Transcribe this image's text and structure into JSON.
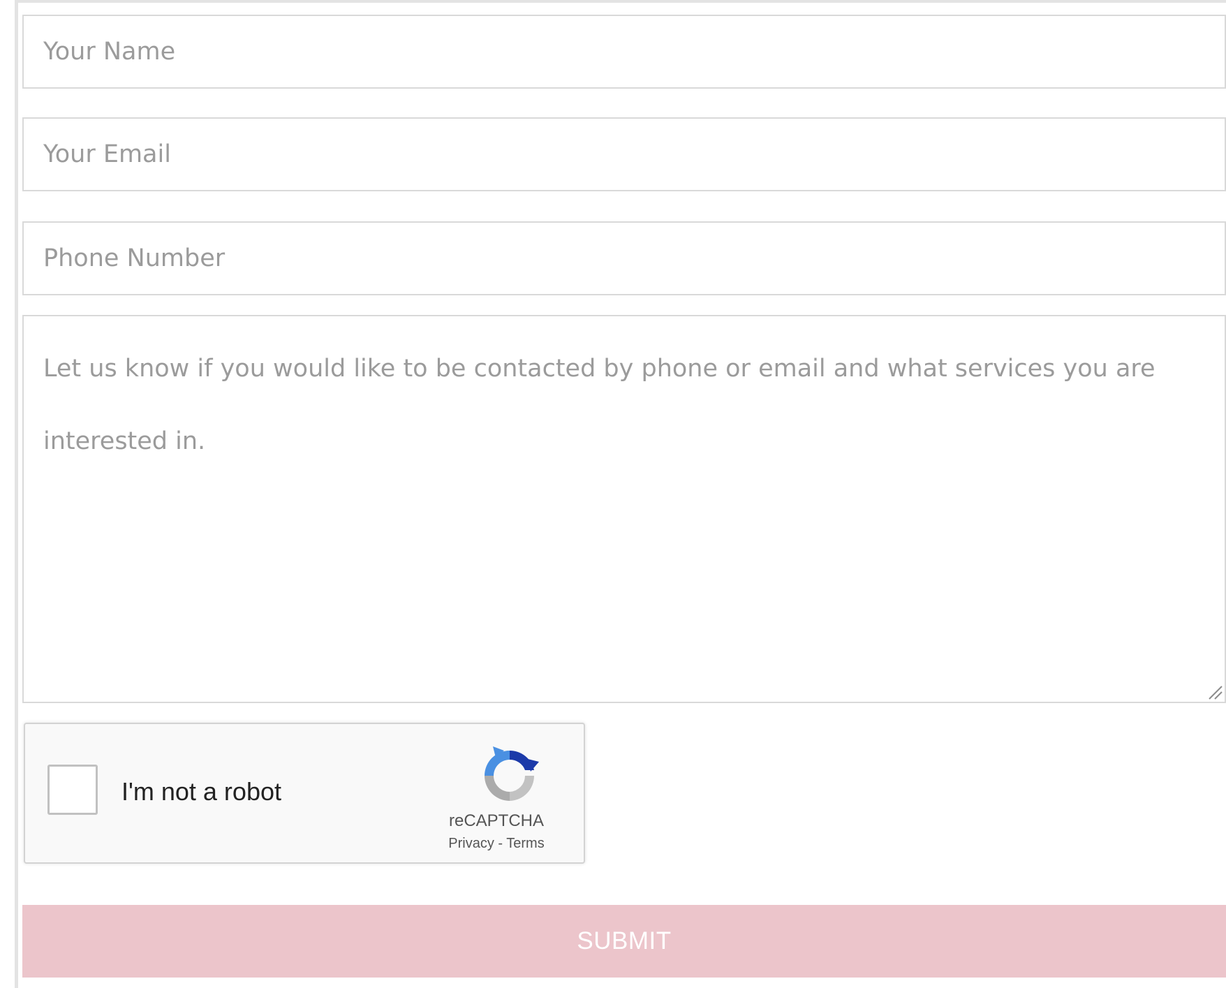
{
  "form": {
    "name_placeholder": "Your Name",
    "email_placeholder": "Your Email",
    "phone_placeholder": "Phone Number",
    "message_placeholder": "Let us know if you would like to be contacted by phone or email and what services you are interested in.",
    "submit_label": "SUBMIT"
  },
  "recaptcha": {
    "label": "I'm not a robot",
    "brand": "reCAPTCHA",
    "privacy_link": "Privacy",
    "separator": " - ",
    "terms_link": "Terms",
    "icon": "recaptcha-logo-icon"
  },
  "colors": {
    "submit_bg": "#ecc5cb",
    "submit_text": "#ffffff",
    "field_border": "#d9d9d9",
    "placeholder": "#9b9b9b"
  }
}
